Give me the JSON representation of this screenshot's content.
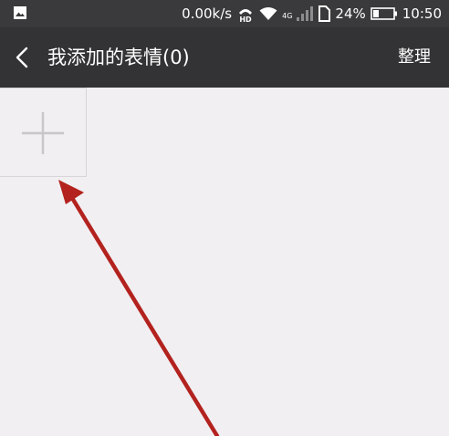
{
  "status_bar": {
    "network_speed": "0.00k/s",
    "hd_badge": "HD",
    "network_type": "4G",
    "battery_percent": "24%",
    "time": "10:50",
    "icons": [
      "image-notification-icon",
      "hd-call-icon",
      "wifi-icon",
      "signal-icon",
      "sim-icon",
      "battery-icon"
    ]
  },
  "app_bar": {
    "title": "我添加的表情(0)",
    "action_label": "整理",
    "back_icon": "back-chevron-icon"
  },
  "content": {
    "add_tile_icon": "plus-icon"
  },
  "colors": {
    "status_bar_bg": "#3a3a3c",
    "app_bar_bg": "#333335",
    "content_bg": "#f1eff2",
    "plus_color": "#c8c6c9",
    "annotation_arrow": "#b3221e"
  }
}
